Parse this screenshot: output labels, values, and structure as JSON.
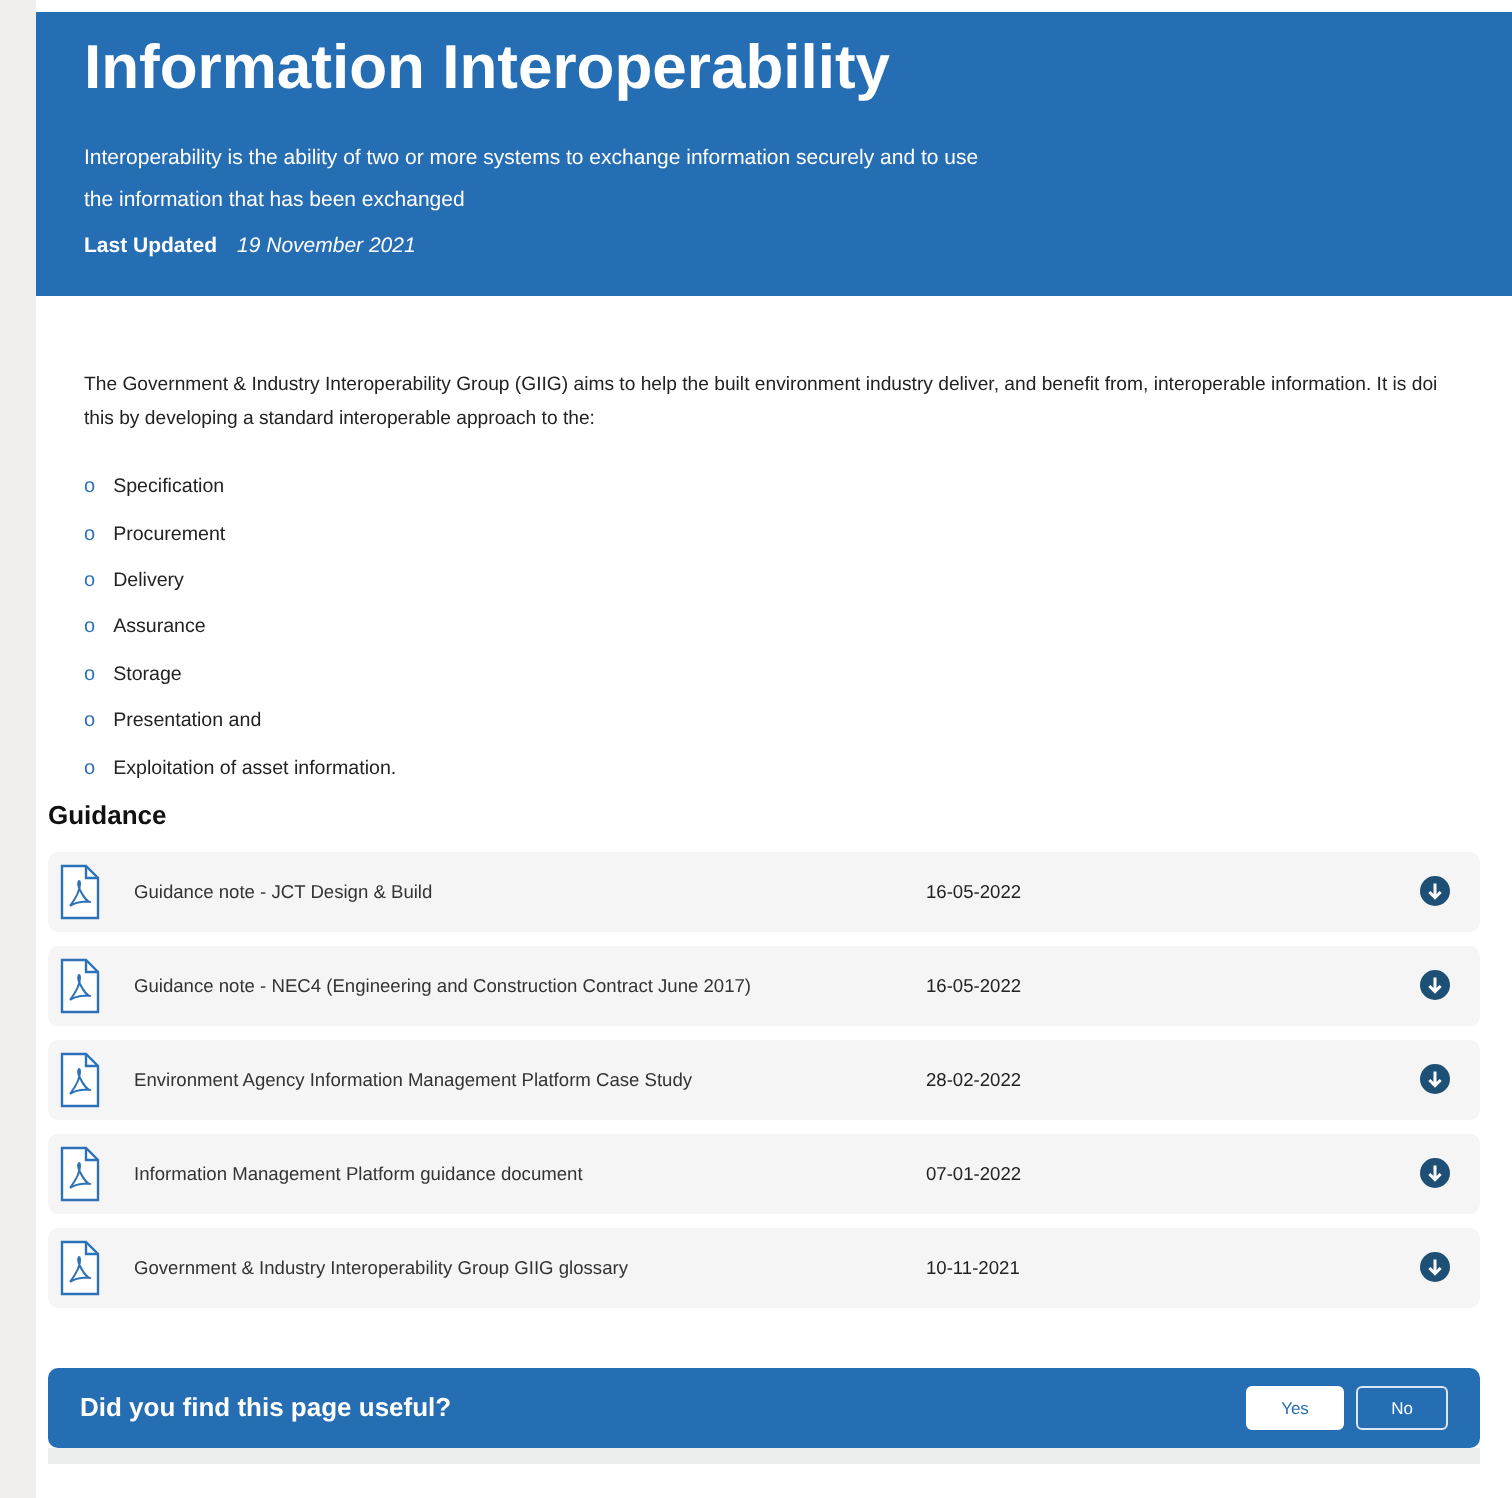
{
  "header": {
    "title": "Information Interoperability",
    "summary_lines": [
      "Interoperability is the ability of two or more systems to exchange information securely and to use",
      "the information that has been exchanged"
    ],
    "updated_label": "Last Updated",
    "updated_date": "19 November 2021"
  },
  "intro": {
    "lines": [
      "The Government & Industry Interoperability Group (GIIG) aims to help the built environment industry deliver, and benefit from, interoperable information. It is doi",
      "this by developing a standard interoperable approach to the:"
    ],
    "bullets": [
      {
        "marker": "o",
        "text": "Specification"
      },
      {
        "marker": "o",
        "text": "Procurement"
      },
      {
        "marker": "o",
        "text": "Delivery"
      },
      {
        "marker": "o",
        "text": "Assurance"
      },
      {
        "marker": "o",
        "text": "Storage"
      },
      {
        "marker": "o",
        "text": "Presentation and"
      },
      {
        "marker": "o",
        "text": "Exploitation of asset information."
      }
    ]
  },
  "guidance": {
    "heading": "Guidance",
    "documents": [
      {
        "title": "Guidance note - JCT Design & Build",
        "date": "16-05-2022"
      },
      {
        "title": "Guidance note - NEC4 (Engineering and Construction Contract June 2017)",
        "date": "16-05-2022"
      },
      {
        "title": "Environment Agency Information Management Platform Case Study",
        "date": "28-02-2022"
      },
      {
        "title": "Information Management Platform guidance document",
        "date": "07-01-2022"
      },
      {
        "title": "Government & Industry Interoperability Group GIIG glossary",
        "date": "10-11-2021"
      }
    ]
  },
  "feedback": {
    "question": "Did you find this page useful?",
    "buttons": [
      {
        "label": "Yes",
        "kind": "filled"
      },
      {
        "label": "No",
        "kind": "outline"
      }
    ]
  }
}
